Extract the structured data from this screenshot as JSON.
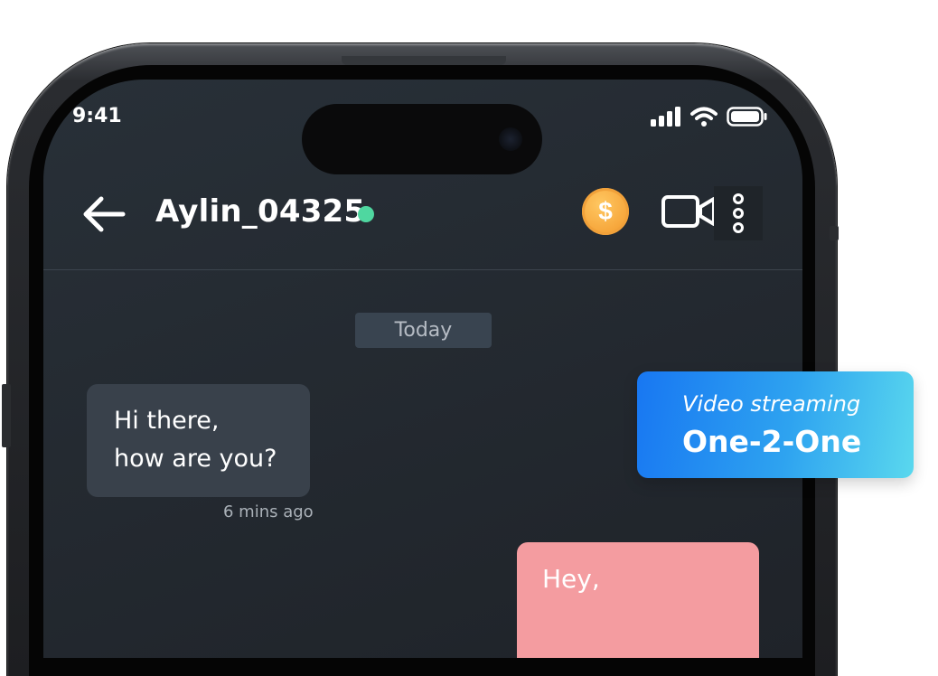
{
  "status_bar": {
    "time": "9:41"
  },
  "chat_header": {
    "contact_name": "Aylin_04325",
    "online_color": "#4fd7a0",
    "coin_symbol": "$"
  },
  "conversation": {
    "date_label": "Today",
    "messages": [
      {
        "direction": "incoming",
        "lines": [
          "Hi there,",
          "how are you?"
        ],
        "time": "6 mins ago"
      },
      {
        "direction": "outgoing",
        "lines": [
          "Hey,"
        ]
      }
    ]
  },
  "feature_card": {
    "subtitle": "Video streaming",
    "title": "One-2-One"
  },
  "colors": {
    "screen_bg": "#252b32",
    "incoming_bubble": "#39414b",
    "outgoing_bubble": "#f49ca0",
    "card_gradient_start": "#1877f2",
    "card_gradient_end": "#5ad8ee",
    "coin": "#f6a53a"
  },
  "icons": [
    "back-arrow-icon",
    "online-status-dot",
    "coin-icon",
    "video-camera-icon",
    "more-vertical-icon",
    "signal-icon",
    "wifi-icon",
    "battery-icon"
  ]
}
